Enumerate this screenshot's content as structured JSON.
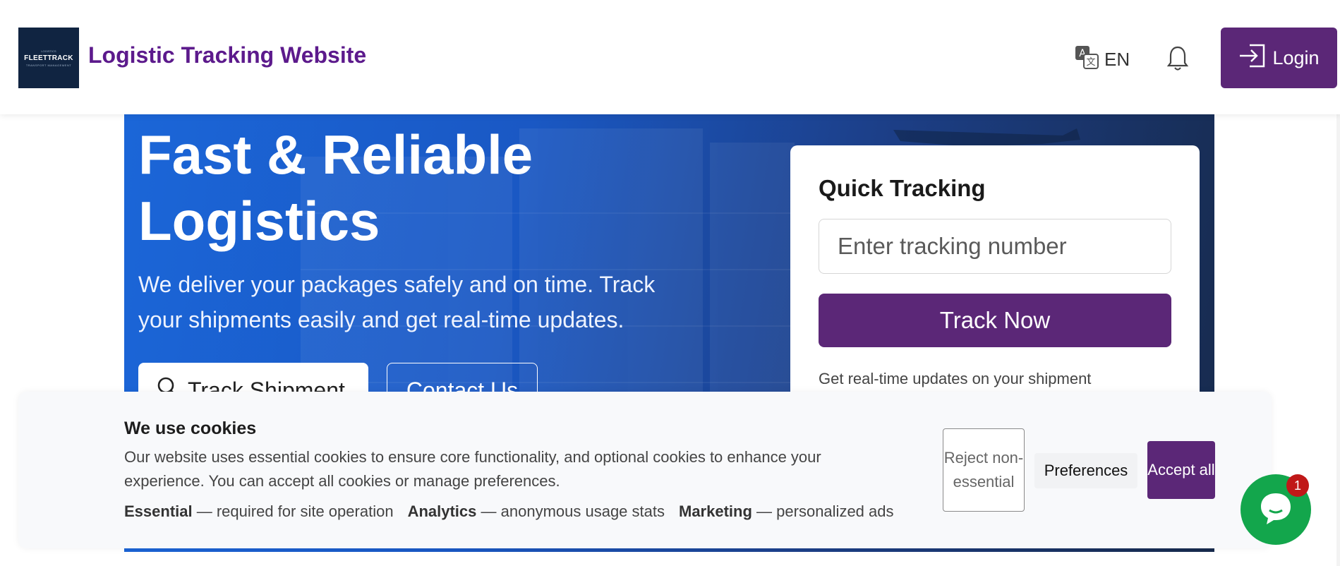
{
  "header": {
    "logo": {
      "top_text": "LOGISTICS",
      "brand": "FLEETTRACK",
      "sub_text": "TRANSPORT MANAGEMENT"
    },
    "site_title": "Logistic Tracking Website",
    "language": "EN",
    "login_label": "Login"
  },
  "hero": {
    "title_line1": "Fast & Reliable",
    "title_line2": "Logistics",
    "subtitle": "We deliver your packages safely and on time. Track your shipments easily and get real-time updates.",
    "track_button": "Track Shipment",
    "contact_button": "Contact Us"
  },
  "quick_tracking": {
    "title": "Quick Tracking",
    "placeholder": "Enter tracking number",
    "button": "Track Now",
    "note": "Get real-time updates on your shipment"
  },
  "cookie": {
    "title": "We use cookies",
    "text": "Our website uses essential cookies to ensure core functionality, and optional cookies to enhance your experience. You can accept all cookies or manage preferences.",
    "categories": [
      {
        "name": "Essential",
        "desc": "— required for site operation"
      },
      {
        "name": "Analytics",
        "desc": "— anonymous usage stats"
      },
      {
        "name": "Marketing",
        "desc": "— personalized ads"
      }
    ],
    "reject_label": "Reject non-essential",
    "preferences_label": "Preferences",
    "accept_label": "Accept all"
  },
  "chat": {
    "badge_count": "1"
  },
  "colors": {
    "brand_purple": "#5b2777",
    "title_purple": "#5c1a8c",
    "chat_green": "#13a64c"
  }
}
